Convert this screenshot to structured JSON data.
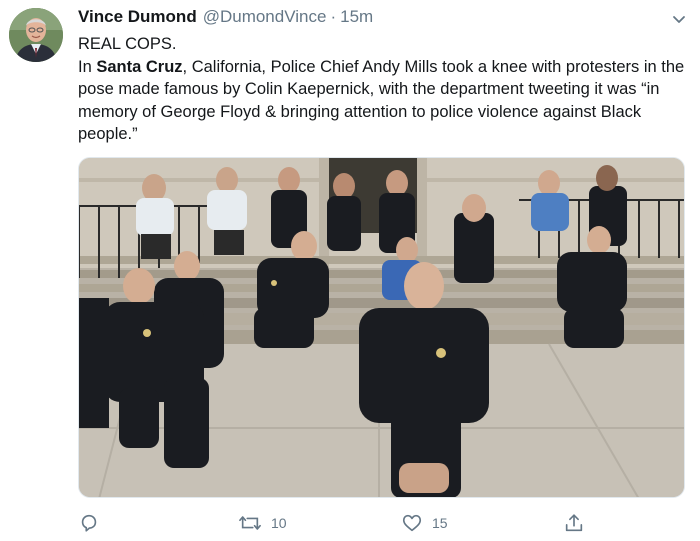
{
  "tweet": {
    "author": {
      "display_name": "Vince Dumond",
      "handle": "@DumondVince",
      "avatar_icon": "profile-photo"
    },
    "separator": "·",
    "timestamp": "15m",
    "text": {
      "line1": "REAL COPS.",
      "prefix": "In ",
      "bold": "Santa Cruz",
      "rest": ", California, Police Chief Andy Mills took a knee with protesters in the pose made famous by Colin Kaepernick, with the department tweeting it was “in memory of George Floyd & bringing attention to police violence against Black people.”"
    },
    "actions": {
      "reply": {
        "icon": "reply-icon",
        "count": ""
      },
      "retweet": {
        "icon": "retweet-icon",
        "count": "10"
      },
      "like": {
        "icon": "heart-icon",
        "count": "15"
      },
      "share": {
        "icon": "share-icon",
        "count": ""
      }
    },
    "colors": {
      "text": "#14171a",
      "secondary": "#657786",
      "border": "#e1e8ed"
    }
  }
}
